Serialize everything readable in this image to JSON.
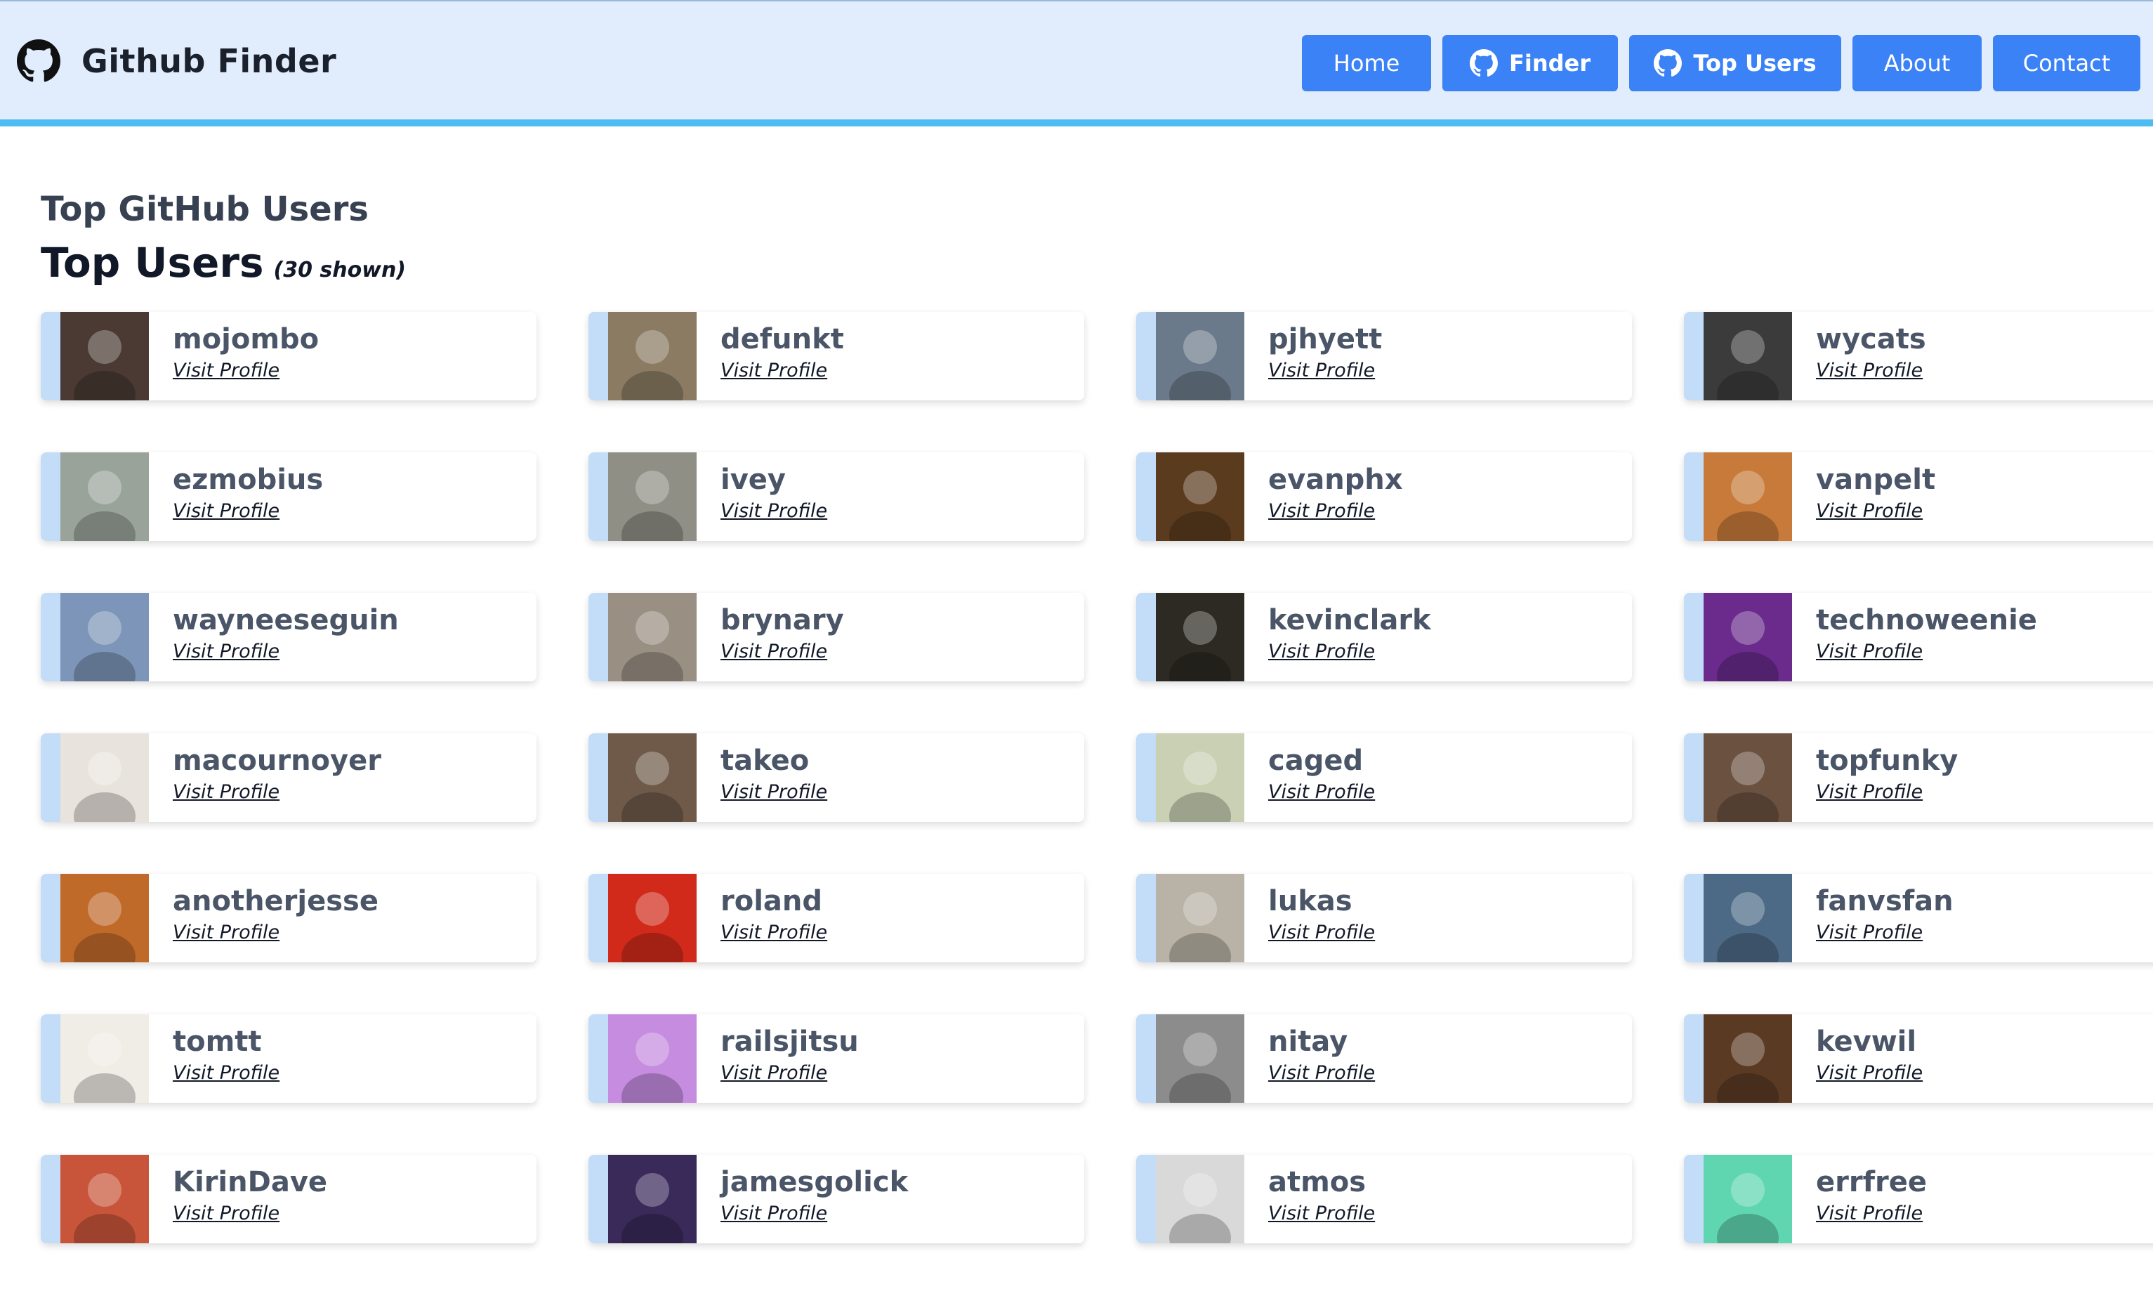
{
  "header": {
    "brand": "Github Finder",
    "nav": {
      "home": "Home",
      "finder": "Finder",
      "top_users": "Top Users",
      "about": "About",
      "contact": "Contact"
    }
  },
  "page": {
    "section_title": "Top GitHub Users",
    "subtitle": "Top Users",
    "count_note": "(30 shown)"
  },
  "colors": {
    "nav_bg": "#e1edfc",
    "nav_border": "#4dbcf0",
    "button": "#3b82f6",
    "card_accent": "#c3dcf7"
  },
  "visit_label": "Visit Profile",
  "users": [
    {
      "login": "mojombo",
      "avatar": "#4a3a33"
    },
    {
      "login": "defunkt",
      "avatar": "#8a7b62"
    },
    {
      "login": "pjhyett",
      "avatar": "#6b7a8a"
    },
    {
      "login": "wycats",
      "avatar": "#3b3b3b"
    },
    {
      "login": "ezmobius",
      "avatar": "#9aa39a"
    },
    {
      "login": "ivey",
      "avatar": "#8f8f86"
    },
    {
      "login": "evanphx",
      "avatar": "#5a3b1e"
    },
    {
      "login": "vanpelt",
      "avatar": "#c77a3a"
    },
    {
      "login": "wayneeseguin",
      "avatar": "#7d95b8"
    },
    {
      "login": "brynary",
      "avatar": "#9a8f83"
    },
    {
      "login": "kevinclark",
      "avatar": "#2c2a22"
    },
    {
      "login": "technoweenie",
      "avatar": "#6a2b8c"
    },
    {
      "login": "macournoyer",
      "avatar": "#e9e3dd"
    },
    {
      "login": "takeo",
      "avatar": "#6f5a4a"
    },
    {
      "login": "caged",
      "avatar": "#c9d0b4"
    },
    {
      "login": "topfunky",
      "avatar": "#6a5140"
    },
    {
      "login": "anotherjesse",
      "avatar": "#c06a2a"
    },
    {
      "login": "roland",
      "avatar": "#d12a1a"
    },
    {
      "login": "lukas",
      "avatar": "#b9b2a6"
    },
    {
      "login": "fanvsfan",
      "avatar": "#4c6a86"
    },
    {
      "login": "tomtt",
      "avatar": "#f0ece6"
    },
    {
      "login": "railsjitsu",
      "avatar": "#c58ce0"
    },
    {
      "login": "nitay",
      "avatar": "#8c8c8c"
    },
    {
      "login": "kevwil",
      "avatar": "#5b3a24"
    },
    {
      "login": "KirinDave",
      "avatar": "#c8553a"
    },
    {
      "login": "jamesgolick",
      "avatar": "#3a2a5a"
    },
    {
      "login": "atmos",
      "avatar": "#d9d9d9"
    },
    {
      "login": "errfree",
      "avatar": "#5fd6b0"
    }
  ]
}
